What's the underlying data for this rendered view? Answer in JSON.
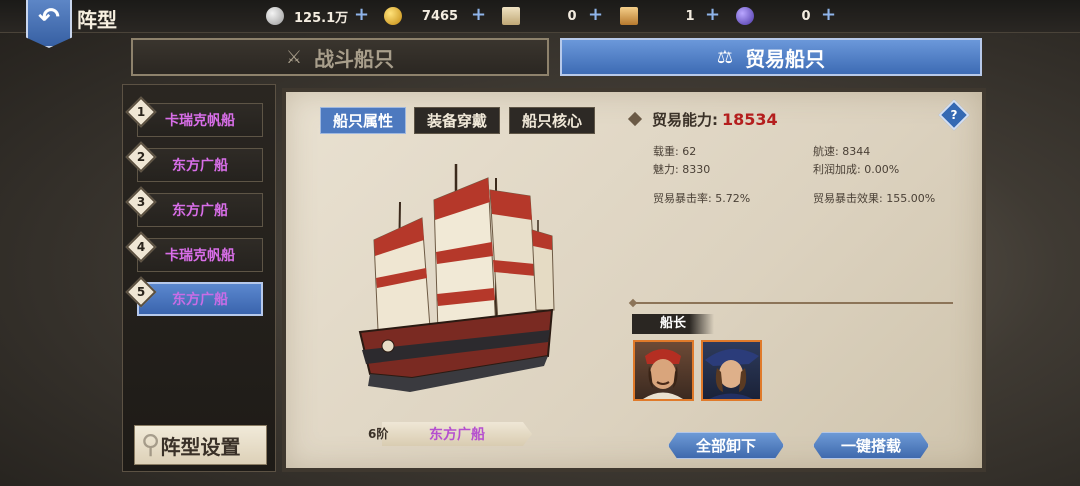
{
  "header": {
    "title": "阵型",
    "resources": [
      {
        "name": "silver",
        "icon": "silver-coin-icon",
        "value": "125.1万",
        "color": "#c9c9c9"
      },
      {
        "name": "gold",
        "icon": "gold-coin-icon",
        "value": "7465",
        "color": "#e8b52a"
      },
      {
        "name": "scroll",
        "icon": "scroll-icon",
        "value": "0",
        "color": "#d9c79c"
      },
      {
        "name": "ticket",
        "icon": "ticket-icon",
        "value": "1",
        "color": "#e8b56b"
      },
      {
        "name": "gem",
        "icon": "gem-icon",
        "value": "0",
        "color": "#7b5fd6"
      }
    ]
  },
  "tabs": {
    "battle": "战斗船只",
    "trade": "贸易船只",
    "active": "trade"
  },
  "sidebar": {
    "slots": [
      {
        "num": "1",
        "label": "卡瑞克帆船",
        "active": false
      },
      {
        "num": "2",
        "label": "东方广船",
        "active": false
      },
      {
        "num": "3",
        "label": "东方广船",
        "active": false
      },
      {
        "num": "4",
        "label": "卡瑞克帆船",
        "active": false
      },
      {
        "num": "5",
        "label": "东方广船",
        "active": true
      }
    ],
    "formation_button": "阵型设置"
  },
  "panel": {
    "subtabs": [
      "船只属性",
      "装备穿戴",
      "船只核心"
    ],
    "active_subtab": "船只属性",
    "ship": {
      "tier": "6阶",
      "name": "东方广船"
    },
    "stats": {
      "trade_power_label": "贸易能力:",
      "trade_power_value": "18534",
      "load": "载重: 62",
      "speed": "航速: 8344",
      "charm": "魅力: 8330",
      "profit_bonus": "利润加成: 0.00%",
      "crit_rate": "贸易暴击率: 5.72%",
      "crit_effect": "贸易暴击效果: 155.00%"
    },
    "help": "?",
    "captain_label": "船长",
    "buttons": {
      "unload_all": "全部卸下",
      "one_click_load": "一键搭载"
    }
  }
}
